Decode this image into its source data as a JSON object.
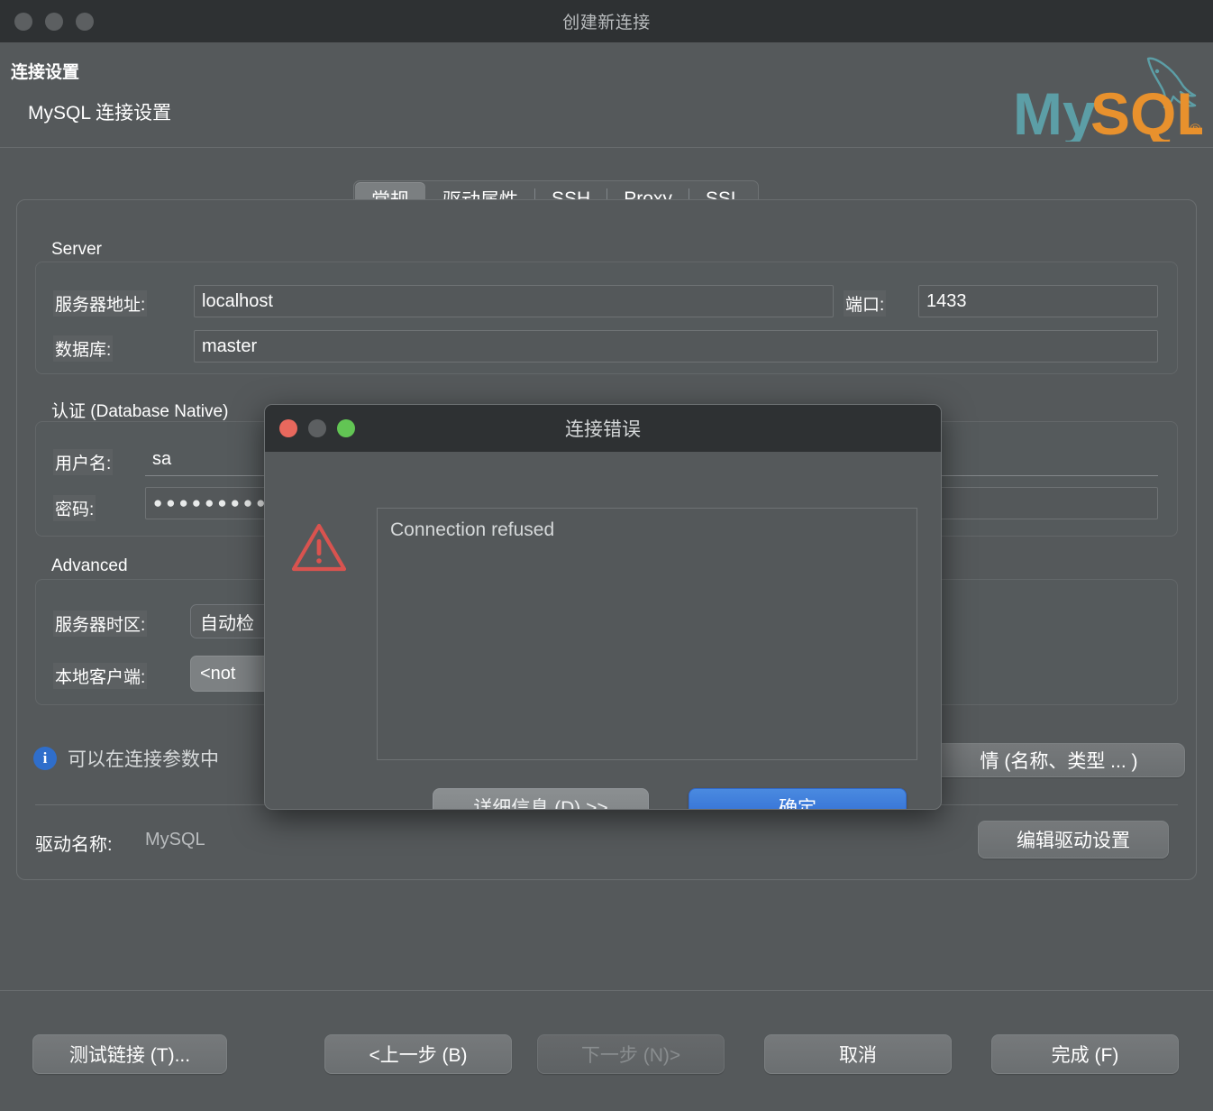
{
  "window": {
    "title": "创建新连接",
    "header_title": "连接设置",
    "header_subtitle": "MySQL 连接设置",
    "logo_text": "MySQL",
    "logo_mark": "mysql-dolphin-logo",
    "traffic_lights": [
      "close-button",
      "minimize-button",
      "zoom-button"
    ]
  },
  "tabs": [
    {
      "label": "常规",
      "active": true
    },
    {
      "label": "驱动属性",
      "active": false
    },
    {
      "label": "SSH",
      "active": false
    },
    {
      "label": "Proxy",
      "active": false
    },
    {
      "label": "SSL",
      "active": false
    }
  ],
  "sections": {
    "server": {
      "title": "Server",
      "host_label": "服务器地址:",
      "host_value": "localhost",
      "port_label": "端口:",
      "port_value": "1433",
      "database_label": "数据库:",
      "database_value": "master"
    },
    "auth": {
      "title": "认证 (Database Native)",
      "user_label": "用户名:",
      "user_value": "sa",
      "password_label": "密码:",
      "password_value": "●●●●●●●●●●●"
    },
    "advanced": {
      "title": "Advanced",
      "timezone_label": "服务器时区:",
      "timezone_value": "自动检",
      "local_client_label": "本地客户端:",
      "local_client_value": "<not"
    }
  },
  "info": {
    "icon": "info-icon",
    "text": "可以在连接参数中",
    "button_label": "情 (名称、类型 ... )"
  },
  "driver": {
    "label": "驱动名称:",
    "value": "MySQL",
    "edit_button": "编辑驱动设置"
  },
  "footer": {
    "test_connection": "测试链接 (T)...",
    "back": "<上一步 (B)",
    "next": "下一步 (N)>",
    "cancel": "取消",
    "finish": "完成 (F)"
  },
  "dialog": {
    "title": "连接错误",
    "icon": "warning-triangle-icon",
    "message": "Connection refused",
    "details_button": "详细信息 (D) >>",
    "ok_button": "确定",
    "traffic_lights": [
      "close-button",
      "minimize-button",
      "zoom-button"
    ]
  },
  "colors": {
    "window_bg": "#55595b",
    "titlebar_bg": "#2e3133",
    "accent_blue": "#2f6ad2",
    "error_red": "#d9534f",
    "logo_teal": "#5c9ea6",
    "logo_orange": "#e8912d",
    "info_blue": "#2f6ecb"
  }
}
